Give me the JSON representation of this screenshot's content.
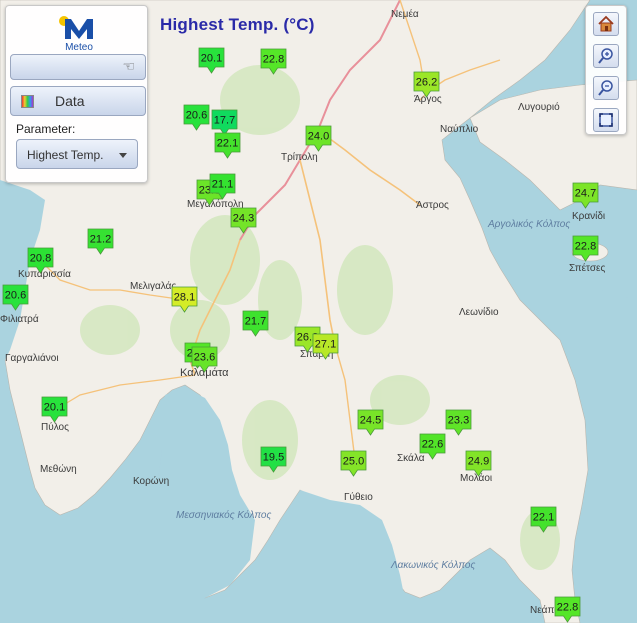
{
  "map": {
    "title": "Highest Temp. (°C)",
    "place_labels": [
      {
        "name": "Νεμέα"
      },
      {
        "name": "Άργος"
      },
      {
        "name": "Λυγουριό"
      },
      {
        "name": "Ναύπλιο"
      },
      {
        "name": "Τρίπολη"
      },
      {
        "name": "Άστρος"
      },
      {
        "name": "Αργολικός Κόλπος"
      },
      {
        "name": "Κρανίδι"
      },
      {
        "name": "Σπέτσες"
      },
      {
        "name": "Μεγαλόπολη"
      },
      {
        "name": "Κυπαρισσία"
      },
      {
        "name": "Φιλιατρά"
      },
      {
        "name": "Μελιγαλάς"
      },
      {
        "name": "Λεωνίδιο"
      },
      {
        "name": "Σπάρτη"
      },
      {
        "name": "Γαργαλιάνοι"
      },
      {
        "name": "Καλαμάτα"
      },
      {
        "name": "Πύλος"
      },
      {
        "name": "Μεθώνη"
      },
      {
        "name": "Κορώνη"
      },
      {
        "name": "Σκάλα"
      },
      {
        "name": "Μολάοι"
      },
      {
        "name": "Γύθειο"
      },
      {
        "name": "Μεσσηνιακός Κόλπος"
      },
      {
        "name": "Λακωνικός Κόλπος"
      },
      {
        "name": "Νεάπολη"
      }
    ],
    "stations": [
      {
        "value": "20.1",
        "color": "#28e23c"
      },
      {
        "value": "22.8",
        "color": "#55e628"
      },
      {
        "value": "26.2",
        "color": "#9be628"
      },
      {
        "value": "20.6",
        "color": "#28e23c"
      },
      {
        "value": "17.7",
        "color": "#10da5e"
      },
      {
        "value": "22.1",
        "color": "#44e22c"
      },
      {
        "value": "24.0",
        "color": "#6de428"
      },
      {
        "value": "23.8",
        "color": "#6be428"
      },
      {
        "value": "21.1",
        "color": "#34e230"
      },
      {
        "value": "24.3",
        "color": "#74e428"
      },
      {
        "value": "24.7",
        "color": "#7ce428"
      },
      {
        "value": "22.8",
        "color": "#55e628"
      },
      {
        "value": "20.8",
        "color": "#2ce234"
      },
      {
        "value": "21.2",
        "color": "#36e232"
      },
      {
        "value": "20.6",
        "color": "#28e23c"
      },
      {
        "value": "28.1",
        "color": "#d4ec28"
      },
      {
        "value": "21.7",
        "color": "#3ee22e"
      },
      {
        "value": "26.2",
        "color": "#9be628"
      },
      {
        "value": "27.1",
        "color": "#b8e828"
      },
      {
        "value": "22.8",
        "color": "#55e628"
      },
      {
        "value": "23.6",
        "color": "#67e428"
      },
      {
        "value": "20.1",
        "color": "#28e23c"
      },
      {
        "value": "24.5",
        "color": "#78e428"
      },
      {
        "value": "23.3",
        "color": "#60e428"
      },
      {
        "value": "22.6",
        "color": "#52e428"
      },
      {
        "value": "19.5",
        "color": "#22e045"
      },
      {
        "value": "25.0",
        "color": "#84e428"
      },
      {
        "value": "24.9",
        "color": "#82e428"
      },
      {
        "value": "22.1",
        "color": "#44e22c"
      },
      {
        "value": "22.8",
        "color": "#55e628"
      }
    ]
  },
  "panel": {
    "logo_text": "Meteo",
    "data_button_label": "Data",
    "parameter_label": "Parameter:",
    "parameter_selected": "Highest Temp."
  },
  "tools": {
    "icons": [
      "home-icon",
      "zoom-in-icon",
      "zoom-out-icon",
      "fit-extent-icon"
    ]
  }
}
